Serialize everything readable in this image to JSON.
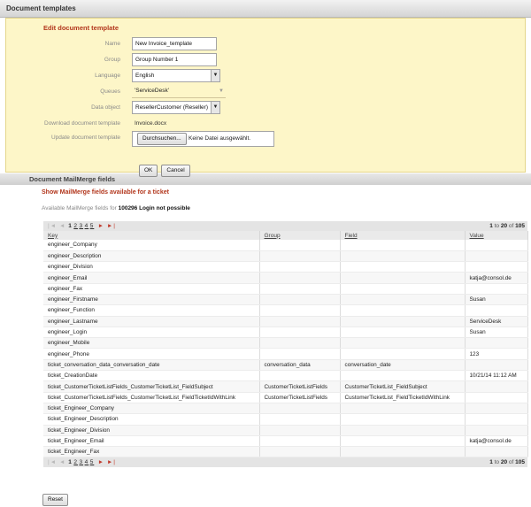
{
  "panel_title": "Document templates",
  "edit": {
    "title": "Edit document template",
    "name_label": "Name",
    "name_value": "New Invoice_template",
    "group_label": "Group",
    "group_value": "Group Number 1",
    "language_label": "Language",
    "language_value": "English",
    "queues_label": "Queues",
    "queues_value": "'ServiceDesk'",
    "data_object_label": "Data object",
    "data_object_value": "ResellerCustomer (Reseller)",
    "download_label": "Download document template",
    "download_value": "Invoice.docx",
    "update_label": "Update document template",
    "browse_label": "Durchsuchen...",
    "no_file_text": "Keine Datei ausgewählt.",
    "ok_label": "OK",
    "cancel_label": "Cancel"
  },
  "mailmerge": {
    "header": "Document MailMerge fields",
    "title": "Show MailMerge fields available for a ticket",
    "avail_prefix": "Available MailMerge fields for",
    "avail_ticket": "100296 Login not possible",
    "pager": {
      "first": "|◄",
      "prev": "◄",
      "pages": [
        "1",
        "2",
        "3",
        "4",
        "5"
      ],
      "next": "►",
      "last": "►|",
      "range": "to",
      "from": "1",
      "to_num": "20",
      "of": "of",
      "total": "105"
    },
    "columns": [
      "Key",
      "Group",
      "Field",
      "Value"
    ],
    "rows": [
      [
        "engineer_Company",
        "",
        "",
        ""
      ],
      [
        "engineer_Description",
        "",
        "",
        ""
      ],
      [
        "engineer_Division",
        "",
        "",
        ""
      ],
      [
        "engineer_Email",
        "",
        "",
        "katja@consol.de"
      ],
      [
        "engineer_Fax",
        "",
        "",
        ""
      ],
      [
        "engineer_Firstname",
        "",
        "",
        "Susan"
      ],
      [
        "engineer_Function",
        "",
        "",
        ""
      ],
      [
        "engineer_Lastname",
        "",
        "",
        "ServiceDesk"
      ],
      [
        "engineer_Login",
        "",
        "",
        "Susan"
      ],
      [
        "engineer_Mobile",
        "",
        "",
        ""
      ],
      [
        "engineer_Phone",
        "",
        "",
        "123"
      ],
      [
        "ticket_conversation_data_conversation_date",
        "conversation_data",
        "conversation_date",
        ""
      ],
      [
        "ticket_CreationDate",
        "",
        "",
        "10/21/14 11:12 AM"
      ],
      [
        "ticket_CustomerTicketListFields_CustomerTicketList_FieldSubject",
        "CustomerTicketListFields",
        "CustomerTicketList_FieldSubject",
        ""
      ],
      [
        "ticket_CustomerTicketListFields_CustomerTicketList_FieldTicketIdWithLink",
        "CustomerTicketListFields",
        "CustomerTicketList_FieldTicketIdWithLink",
        ""
      ],
      [
        "ticket_Engineer_Company",
        "",
        "",
        ""
      ],
      [
        "ticket_Engineer_Description",
        "",
        "",
        ""
      ],
      [
        "ticket_Engineer_Division",
        "",
        "",
        ""
      ],
      [
        "ticket_Engineer_Email",
        "",
        "",
        "katja@consol.de"
      ],
      [
        "ticket_Engineer_Fax",
        "",
        "",
        ""
      ]
    ],
    "reset_label": "Reset"
  }
}
